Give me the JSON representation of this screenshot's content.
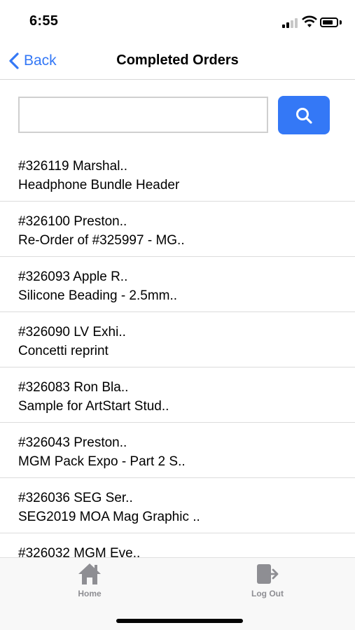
{
  "status_bar": {
    "time": "6:55"
  },
  "nav": {
    "back_label": "Back",
    "title": "Completed Orders"
  },
  "search": {
    "value": "",
    "placeholder": "",
    "button_icon": "search-icon"
  },
  "orders": [
    {
      "line1": "#326119 Marshal..",
      "line2": "Headphone Bundle Header"
    },
    {
      "line1": "#326100 Preston..",
      "line2": "Re-Order of #325997 - MG.."
    },
    {
      "line1": "#326093 Apple R..",
      "line2": "Silicone Beading - 2.5mm.."
    },
    {
      "line1": "#326090 LV Exhi..",
      "line2": "Concetti reprint"
    },
    {
      "line1": "#326083 Ron Bla..",
      "line2": "Sample for ArtStart Stud.."
    },
    {
      "line1": "#326043 Preston..",
      "line2": "MGM Pack Expo - Part 2 S.."
    },
    {
      "line1": "#326036 SEG Ser..",
      "line2": "SEG2019 MOA Mag Graphic .."
    },
    {
      "line1": "#326032 MGM Eve..",
      "line2": ""
    }
  ],
  "tab_bar": {
    "home_label": "Home",
    "logout_label": "Log Out"
  },
  "colors": {
    "accent": "#3478f6",
    "tab_icon": "#8e8e93"
  }
}
